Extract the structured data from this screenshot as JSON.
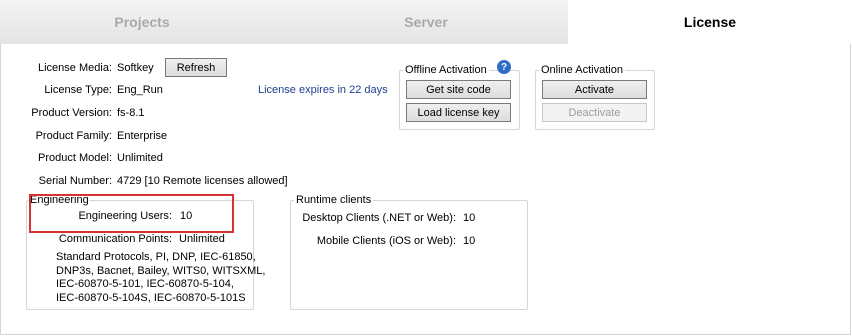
{
  "tabs": [
    {
      "label": "Projects"
    },
    {
      "label": "Server"
    },
    {
      "label": "License"
    }
  ],
  "license": {
    "media_label": "License Media:",
    "media_value": "Softkey",
    "refresh_label": "Refresh",
    "type_label": "License Type:",
    "type_value": "Eng_Run",
    "expiry_text": "License expires in 22 days",
    "version_label": "Product Version:",
    "version_value": "fs-8.1",
    "family_label": "Product Family:",
    "family_value": "Enterprise",
    "model_label": "Product Model:",
    "model_value": "Unlimited",
    "serial_label": "Serial Number:",
    "serial_value": "4729 [10 Remote licenses allowed]"
  },
  "offline": {
    "title": "Offline Activation",
    "help_glyph": "?",
    "get_site_code": "Get site code",
    "load_key": "Load license key"
  },
  "online": {
    "title": "Online Activation",
    "activate": "Activate",
    "deactivate": "Deactivate"
  },
  "engineering": {
    "title": "Engineering",
    "users_label": "Engineering Users:",
    "users_value": "10",
    "points_label": "Communication Points:",
    "points_value": "Unlimited",
    "protocols": [
      "Standard Protocols, PI, DNP, IEC-61850,",
      "DNP3s, Bacnet, Bailey, WITS0, WITSXML,",
      "IEC-60870-5-101, IEC-60870-5-104,",
      "IEC-60870-5-104S, IEC-60870-5-101S"
    ]
  },
  "runtime": {
    "title": "Runtime clients",
    "desktop_label": "Desktop Clients (.NET or Web):",
    "desktop_value": "10",
    "mobile_label": "Mobile Clients (iOS or Web):",
    "mobile_value": "10"
  },
  "colors": {
    "expiry_text": "#1f3f8f",
    "highlight": "#d83232",
    "help_icon": "#2f6ec4"
  }
}
